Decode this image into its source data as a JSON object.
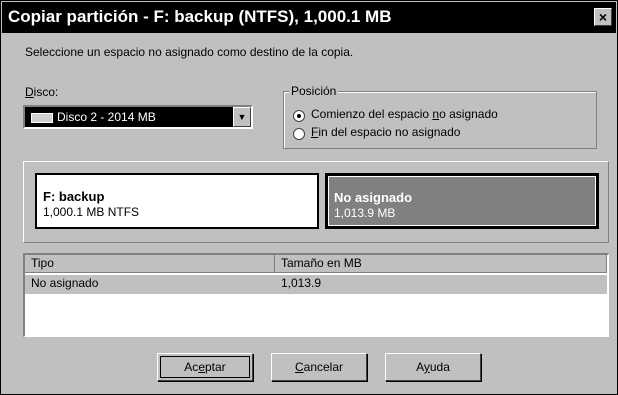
{
  "window": {
    "title": "Copiar partición - F: backup (NTFS), 1,000.1 MB",
    "close_glyph": "×"
  },
  "instruction": "Seleccione un espacio no asignado como destino de la copia.",
  "disk": {
    "label_mnemonic": "D",
    "label_rest": "isco:",
    "selected": "Disco 2 - 2014 MB",
    "icon": "disk-icon"
  },
  "position": {
    "legend": "Posición",
    "options": [
      {
        "before": "Comienzo del espacio ",
        "mnemonic": "n",
        "after": "o asignado",
        "selected": true
      },
      {
        "before": "",
        "mnemonic": "F",
        "after": "in del espacio no asignado",
        "selected": false
      }
    ]
  },
  "partition_map": {
    "source": {
      "name": "F:  backup",
      "detail": "1,000.1 MB   NTFS"
    },
    "target": {
      "name": "No asignado",
      "detail": "1,013.9 MB"
    }
  },
  "table": {
    "columns": [
      "Tipo",
      "Tamaño en MB"
    ],
    "rows": [
      {
        "tipo": "No asignado",
        "size": "1,013.9"
      }
    ]
  },
  "buttons": {
    "accept": {
      "before": "Ac",
      "mnemonic": "e",
      "after": "ptar"
    },
    "cancel": {
      "before": "",
      "mnemonic": "C",
      "after": "ancelar"
    },
    "help": {
      "before": "A",
      "mnemonic": "y",
      "after": "uda"
    }
  }
}
